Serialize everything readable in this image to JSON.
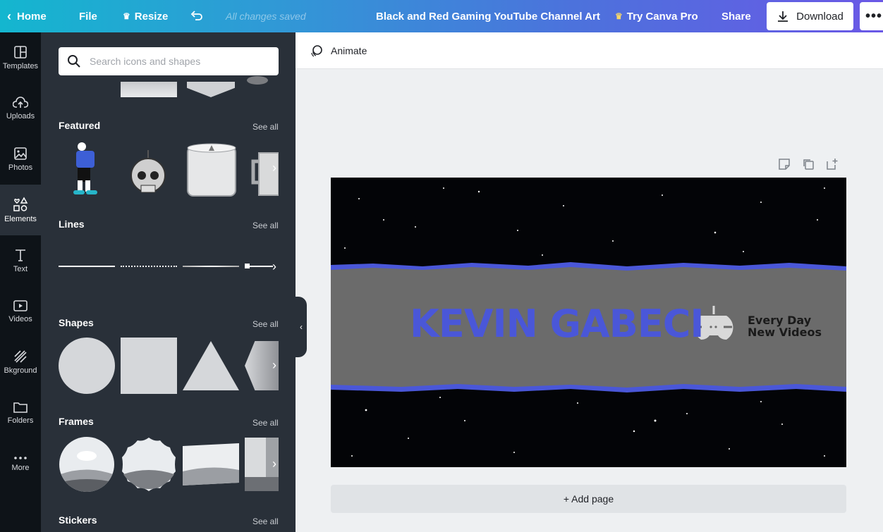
{
  "topbar": {
    "home_label": "Home",
    "file_label": "File",
    "resize_label": "Resize",
    "save_status": "All changes saved",
    "doc_title": "Black and Red Gaming YouTube Channel Art",
    "try_pro_label": "Try Canva Pro",
    "share_label": "Share",
    "download_label": "Download",
    "more_label": "•••"
  },
  "rail": {
    "items": [
      {
        "label": "Templates",
        "icon": "templates-icon"
      },
      {
        "label": "Uploads",
        "icon": "upload-icon"
      },
      {
        "label": "Photos",
        "icon": "photo-icon"
      },
      {
        "label": "Elements",
        "icon": "elements-icon"
      },
      {
        "label": "Text",
        "icon": "text-icon"
      },
      {
        "label": "Videos",
        "icon": "video-icon"
      },
      {
        "label": "Bkground",
        "icon": "background-icon"
      },
      {
        "label": "Folders",
        "icon": "folder-icon"
      },
      {
        "label": "More",
        "icon": "more-icon"
      }
    ]
  },
  "panel": {
    "search_placeholder": "Search icons and shapes",
    "sections": [
      {
        "title": "Featured",
        "see_all": "See all"
      },
      {
        "title": "Lines",
        "see_all": "See all"
      },
      {
        "title": "Shapes",
        "see_all": "See all"
      },
      {
        "title": "Frames",
        "see_all": "See all"
      },
      {
        "title": "Stickers",
        "see_all": "See all"
      }
    ]
  },
  "workspace": {
    "animate_label": "Animate",
    "add_page_label": "+ Add page"
  },
  "design": {
    "channel_name": "KEVIN GABECI",
    "tagline_line1": "Every Day",
    "tagline_line2": "New Videos",
    "accent_color": "#4a57d8",
    "band_color": "#6b6b6b"
  }
}
